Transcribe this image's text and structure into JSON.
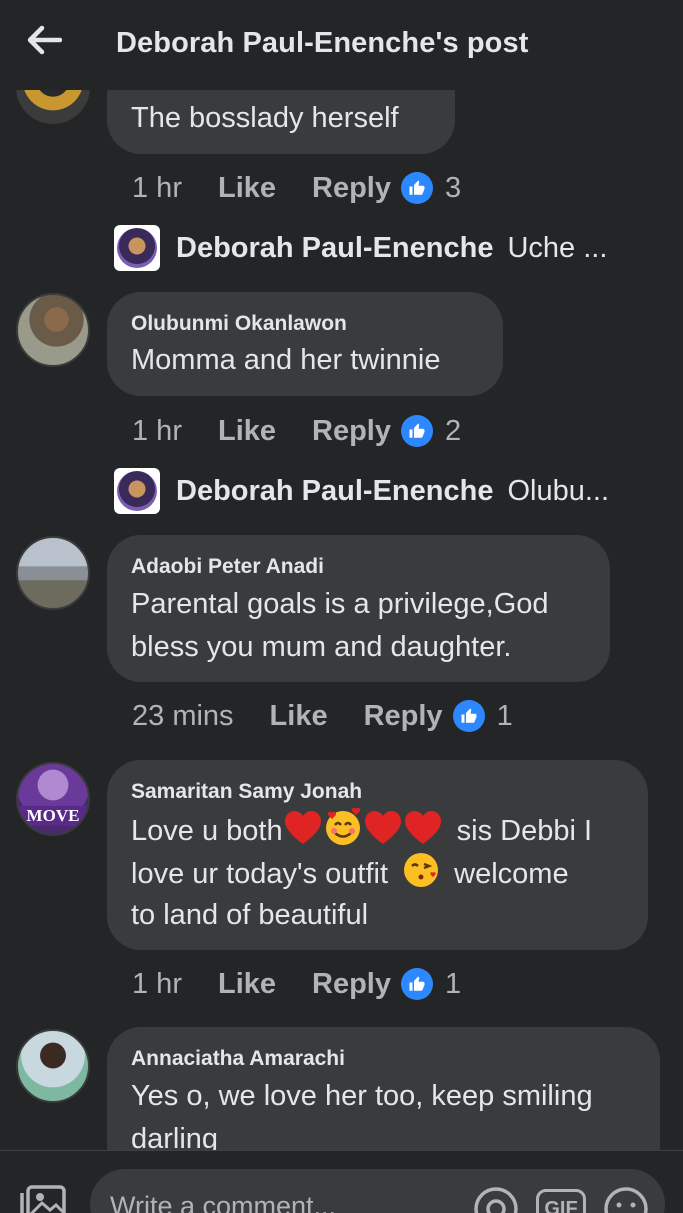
{
  "header": {
    "title": "Deborah Paul-Enenche's post"
  },
  "comments": [
    {
      "text_lines": [
        "The bosslady herself"
      ],
      "time": "1 hr",
      "like": "Like",
      "reply": "Reply",
      "reactions": "3",
      "reply_preview": {
        "name": "Deborah Paul-Enenche",
        "snippet": "Uche ..."
      }
    },
    {
      "name": "Olubunmi Okanlawon",
      "text_lines": [
        "Momma and her twinnie"
      ],
      "time": "1 hr",
      "like": "Like",
      "reply": "Reply",
      "reactions": "2",
      "reply_preview": {
        "name": "Deborah Paul-Enenche",
        "snippet": "Olubu..."
      }
    },
    {
      "name": "Adaobi Peter Anadi",
      "text_lines": [
        "Parental goals is a privilege,God",
        "bless you mum and daughter."
      ],
      "time": "23 mins",
      "like": "Like",
      "reply": "Reply",
      "reactions": "1"
    },
    {
      "name": "Samaritan Samy Jonah",
      "text_parts": [
        "Love u both",
        "sis Debbi I",
        "love ur today's outfit",
        "welcome",
        "to land of beautiful"
      ],
      "avatar_text": "MOVE",
      "time": "1 hr",
      "like": "Like",
      "reply": "Reply",
      "reactions": "1"
    },
    {
      "name": "Annaciatha Amarachi",
      "text_lines": [
        "Yes o, we love her too, keep smiling",
        "darling"
      ]
    }
  ],
  "footer": {
    "placeholder": "Write a comment...",
    "gif_label": "GIF"
  },
  "colors": {
    "background": "#242526",
    "bubble": "#3a3b3c",
    "like_blue": "#2d88ff",
    "meta": "#b0b3b8"
  }
}
